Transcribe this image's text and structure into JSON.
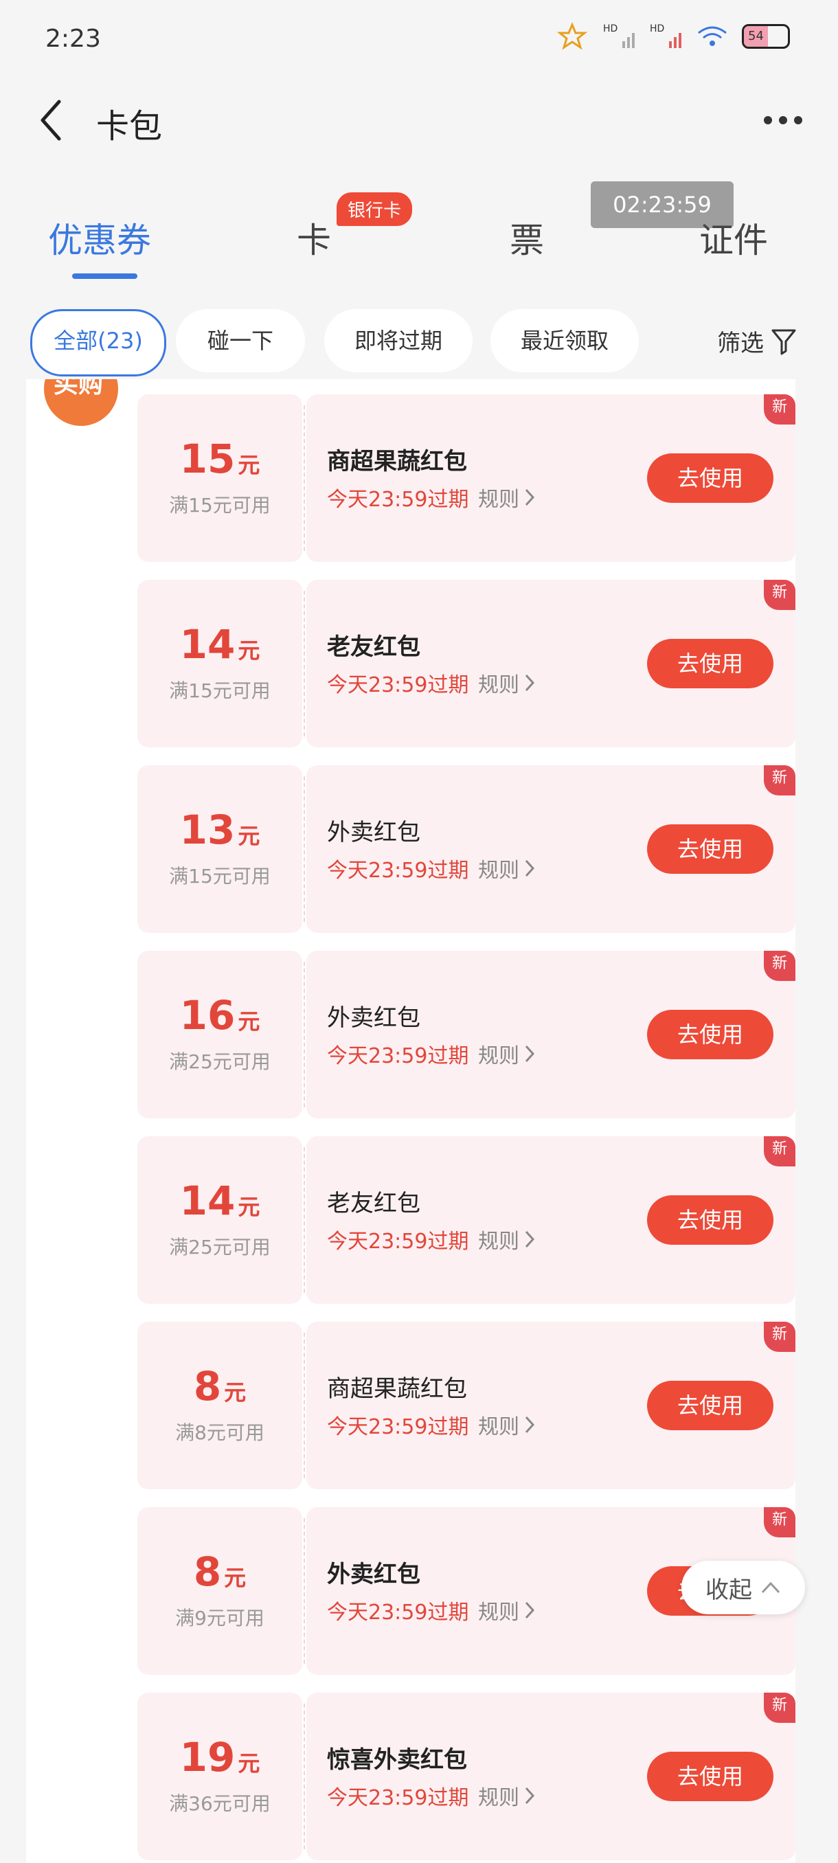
{
  "status_bar": {
    "time": "2:23",
    "battery": "54"
  },
  "header": {
    "title": "卡包"
  },
  "tabs": [
    {
      "label": "优惠券"
    },
    {
      "label": "卡",
      "badge": "银行卡"
    },
    {
      "label": "票"
    },
    {
      "label": "证件"
    }
  ],
  "timer": "02:23:59",
  "filters": {
    "chips": [
      "全部(23)",
      "碰一下",
      "即将过期",
      "最近领取"
    ],
    "filter_label": "筛选"
  },
  "brand_logo_text": "买购",
  "coupons": [
    {
      "amount": "15",
      "unit": "元",
      "condition": "满15元可用",
      "title": "商超果蔬红包",
      "expiry": "今天23:59过期",
      "rule": "规则",
      "button": "去使用",
      "tag": "新"
    },
    {
      "amount": "14",
      "unit": "元",
      "condition": "满15元可用",
      "title": "老友红包",
      "expiry": "今天23:59过期",
      "rule": "规则",
      "button": "去使用",
      "tag": "新"
    },
    {
      "amount": "13",
      "unit": "元",
      "condition": "满15元可用",
      "title": "外卖红包",
      "expiry": "今天23:59过期",
      "rule": "规则",
      "button": "去使用",
      "tag": "新"
    },
    {
      "amount": "16",
      "unit": "元",
      "condition": "满25元可用",
      "title": "外卖红包",
      "expiry": "今天23:59过期",
      "rule": "规则",
      "button": "去使用",
      "tag": "新"
    },
    {
      "amount": "14",
      "unit": "元",
      "condition": "满25元可用",
      "title": "老友红包",
      "expiry": "今天23:59过期",
      "rule": "规则",
      "button": "去使用",
      "tag": "新"
    },
    {
      "amount": "8",
      "unit": "元",
      "condition": "满8元可用",
      "title": "商超果蔬红包",
      "expiry": "今天23:59过期",
      "rule": "规则",
      "button": "去使用",
      "tag": "新"
    },
    {
      "amount": "8",
      "unit": "元",
      "condition": "满9元可用",
      "title": "外卖红包",
      "expiry": "今天23:59过期",
      "rule": "规则",
      "button": "去使用",
      "tag": "新"
    },
    {
      "amount": "19",
      "unit": "元",
      "condition": "满36元可用",
      "title": "惊喜外卖红包",
      "expiry": "今天23:59过期",
      "rule": "规则",
      "button": "去使用",
      "tag": "新"
    }
  ],
  "collapse": {
    "label": "收起"
  },
  "colors": {
    "accent_blue": "#3a78e0",
    "red": "#ee4a38",
    "coupon_bg": "#fcf0f2"
  }
}
